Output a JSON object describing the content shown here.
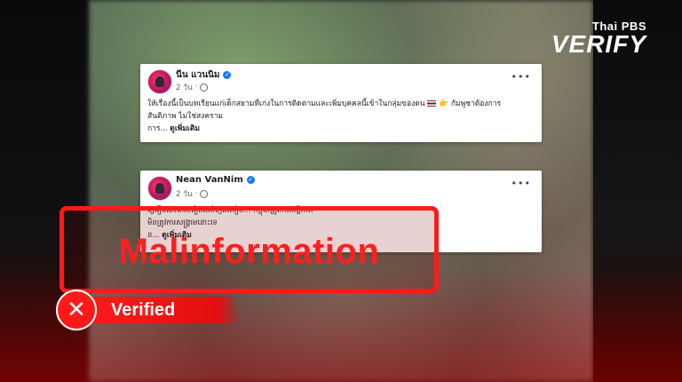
{
  "brand": {
    "small": "Thai PBS",
    "big": "VERIFY"
  },
  "posts": [
    {
      "author": "นีน แวนนิม",
      "time": "2 วัน",
      "body_line1": "ให้เรื่องนี้เป็นบทเรียนแก่เด็กสยามที่เก่งในการติดตามและเพิ่มบุคคลนี้เข้าในกลุ่มของตน",
      "body_line1_tail": "กัมพูชาต้องการ",
      "body_line2": "สันติภาพ ไม่ใช่สงคราม",
      "prefix": "การ...",
      "see_more": "ดูเพิ่มเติม"
    },
    {
      "author": "Nean VanNim",
      "time": "2 วัน",
      "body_line1": "ឲ្យរឿងនេះជាមេរៀនដល់ក្មេងសៀម... កម្ពុជាត្រូវការសន្តិភាព",
      "body_line2": "មិនត្រូវការសង្គ្រាមនោះទេ",
      "prefix": "ន...",
      "see_more": "ดูเพิ่มเติม"
    }
  ],
  "stamp": {
    "label": "Malinformation",
    "color": "#ff1f1f"
  },
  "verdict": {
    "label": "Verified",
    "icon": "x-icon",
    "color": "#ff1a1a"
  }
}
